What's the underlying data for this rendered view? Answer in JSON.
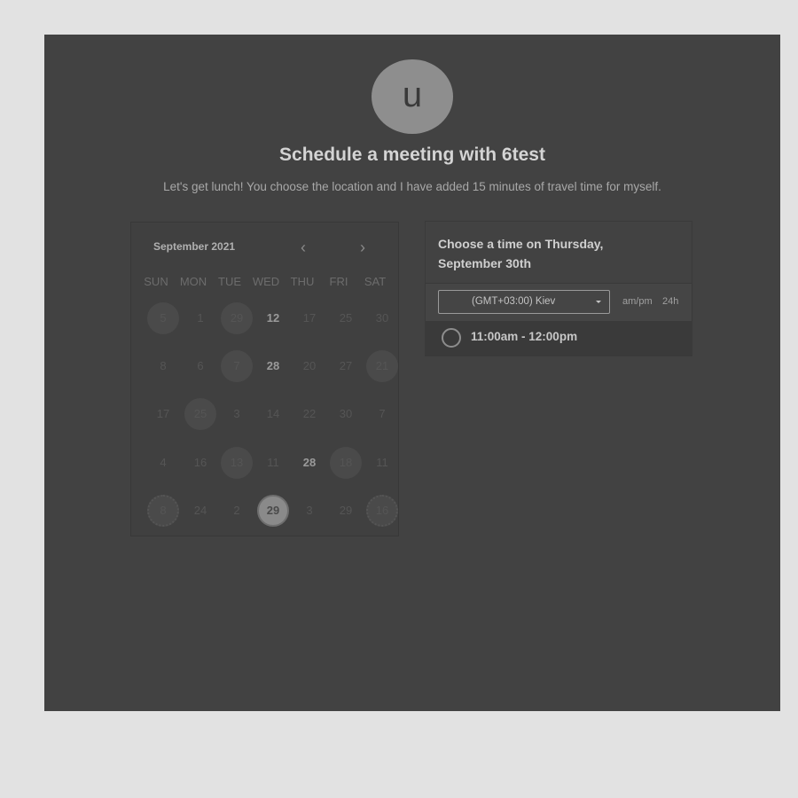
{
  "avatar": {
    "initial": "u"
  },
  "header": {
    "title": "Schedule a meeting with 6test",
    "subtitle": "Let's get lunch! You choose the location and I have added 15 minutes of travel time for myself."
  },
  "calendar": {
    "month_label": "September 2021",
    "prev_icon": "chevron-left-icon",
    "next_icon": "chevron-right-icon",
    "prev_glyph": "‹",
    "next_glyph": "›",
    "weekdays": [
      "SUN",
      "MON",
      "TUE",
      "WED",
      "THU",
      "FRI",
      "SAT"
    ],
    "weeks": [
      [
        "5",
        "1",
        "29",
        "12",
        "17",
        "25",
        "30"
      ],
      [
        "8",
        "6",
        "7",
        "28",
        "20",
        "27",
        "21"
      ],
      [
        "17",
        "25",
        "3",
        "14",
        "22",
        "30",
        "7"
      ],
      [
        "4",
        "16",
        "13",
        "11",
        "28",
        "18",
        "11"
      ],
      [
        "8",
        "24",
        "2",
        "29",
        "3",
        "29",
        "16"
      ]
    ],
    "selected_day": "29"
  },
  "time_panel": {
    "title": "Choose a time on Thursday, September 30th",
    "timezone": "(GMT+03:00) Kiev",
    "format_ampm": "am/pm",
    "format_24h": "24h",
    "slots": [
      "11:00am - 12:00pm"
    ]
  },
  "colors": {
    "background": "#e2e2e2",
    "stage": "#424242",
    "avatar": "#8e8e8e"
  }
}
